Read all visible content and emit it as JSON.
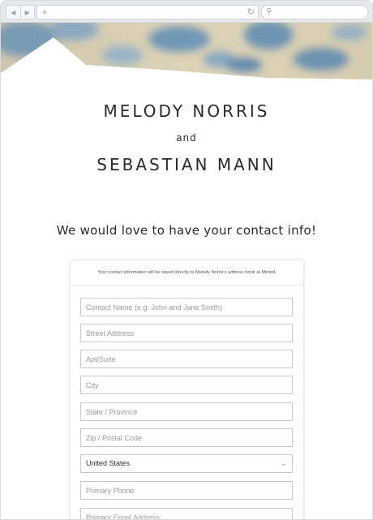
{
  "browser": {
    "back_icon": "◀",
    "forward_icon": "▶",
    "new_tab_icon": "+",
    "reload_icon": "↻",
    "search_icon": "🔍"
  },
  "invite": {
    "name1": "MELODY NORRIS",
    "connector": "and",
    "name2": "SEBASTIAN MANN",
    "headline": "We would love to have your contact info!"
  },
  "form": {
    "notice": "Your contact information will be saved directly to Melody Norris's address book at Minted.",
    "contact_name_placeholder": "Contact Name (e.g. John and Jane Smith)",
    "street_placeholder": "Street Address",
    "apt_placeholder": "Apt/Suite",
    "city_placeholder": "City",
    "state_placeholder": "State / Province",
    "zip_placeholder": "Zip / Postal Code",
    "country_value": "United States",
    "phone_placeholder": "Primary Phone",
    "email_placeholder": "Primary Email Address"
  },
  "colors": {
    "watercolor_blue": "#5f8fb8",
    "watercolor_sand": "#d9cdb0",
    "text": "#2a2a2a"
  }
}
